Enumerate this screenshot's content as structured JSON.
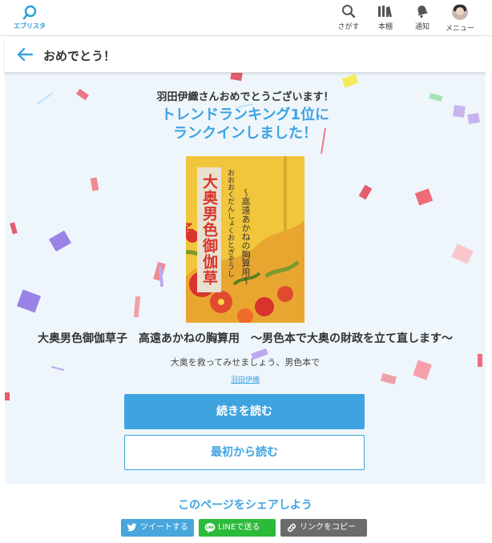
{
  "app": {
    "logo_text": "エブリスタ"
  },
  "nav": {
    "search_label": "さがす",
    "bookshelf_label": "本棚",
    "notifications_label": "通知",
    "menu_label": "メニュー"
  },
  "header": {
    "title": "おめでとう！"
  },
  "congrats": {
    "message": "羽田伊織さんおめでとうございます！",
    "headline_line1": "トレンドランキング1位に",
    "headline_line2": "ランクインしました！"
  },
  "book": {
    "cover_title": "大奥男色御伽草子",
    "cover_ruby": "おおおくだんしょくおとぎぞうし",
    "cover_subtitle": "〜高遠あかねの胸算用〜",
    "title": "大奥男色御伽草子　高遠あかねの胸算用　〜男色本で大奥の財政を立て直します〜",
    "catchcopy": "大奥を救ってみせましょう、男色本で",
    "author": "羽田伊織"
  },
  "actions": {
    "continue_label": "続きを読む",
    "from_start_label": "最初から読む"
  },
  "share": {
    "title": "このページをシェアしよう",
    "tweet_label": "ツイートする",
    "line_label": "LINEで送る",
    "copy_label": "リンクをコピー"
  },
  "colors": {
    "accent": "#3fa3e0",
    "line_green": "#2cba3a",
    "copy_gray": "#6b6b6b",
    "stage_bg": "#eef6fc"
  }
}
